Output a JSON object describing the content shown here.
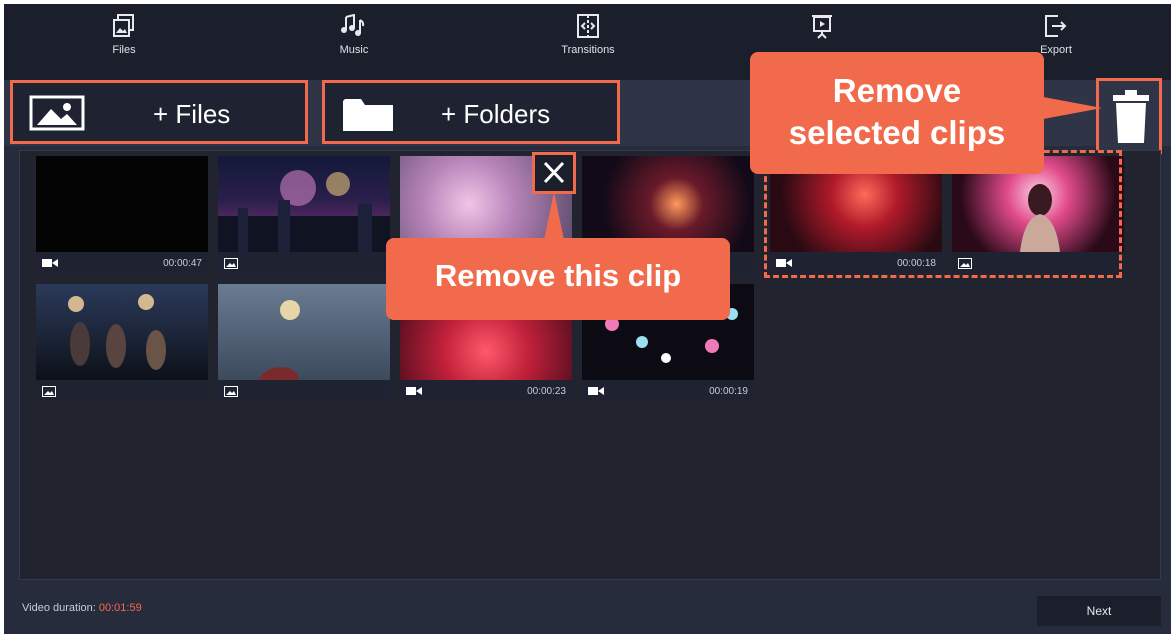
{
  "nav": {
    "files": "Files",
    "music": "Music",
    "transitions": "Transitions",
    "export": "Export"
  },
  "toolbar": {
    "add_files": "+ Files",
    "add_folders": "+ Folders"
  },
  "callouts": {
    "remove_selected": "Remove selected clips",
    "remove_this": "Remove this clip"
  },
  "clips": [
    {
      "type": "video",
      "duration": "00:00:47"
    },
    {
      "type": "image",
      "duration": ""
    },
    {
      "type": "image",
      "duration": ""
    },
    {
      "type": "image",
      "duration": ""
    },
    {
      "type": "video",
      "duration": "00:00:18"
    },
    {
      "type": "image",
      "duration": ""
    },
    {
      "type": "image",
      "duration": ""
    },
    {
      "type": "image",
      "duration": ""
    },
    {
      "type": "video",
      "duration": "00:00:23"
    },
    {
      "type": "video",
      "duration": "00:00:19"
    }
  ],
  "footer": {
    "duration_label": "Video duration:",
    "duration_value": "00:01:59",
    "next": "Next"
  },
  "colors": {
    "accent": "#f26a4c",
    "background": "#272c3c"
  }
}
